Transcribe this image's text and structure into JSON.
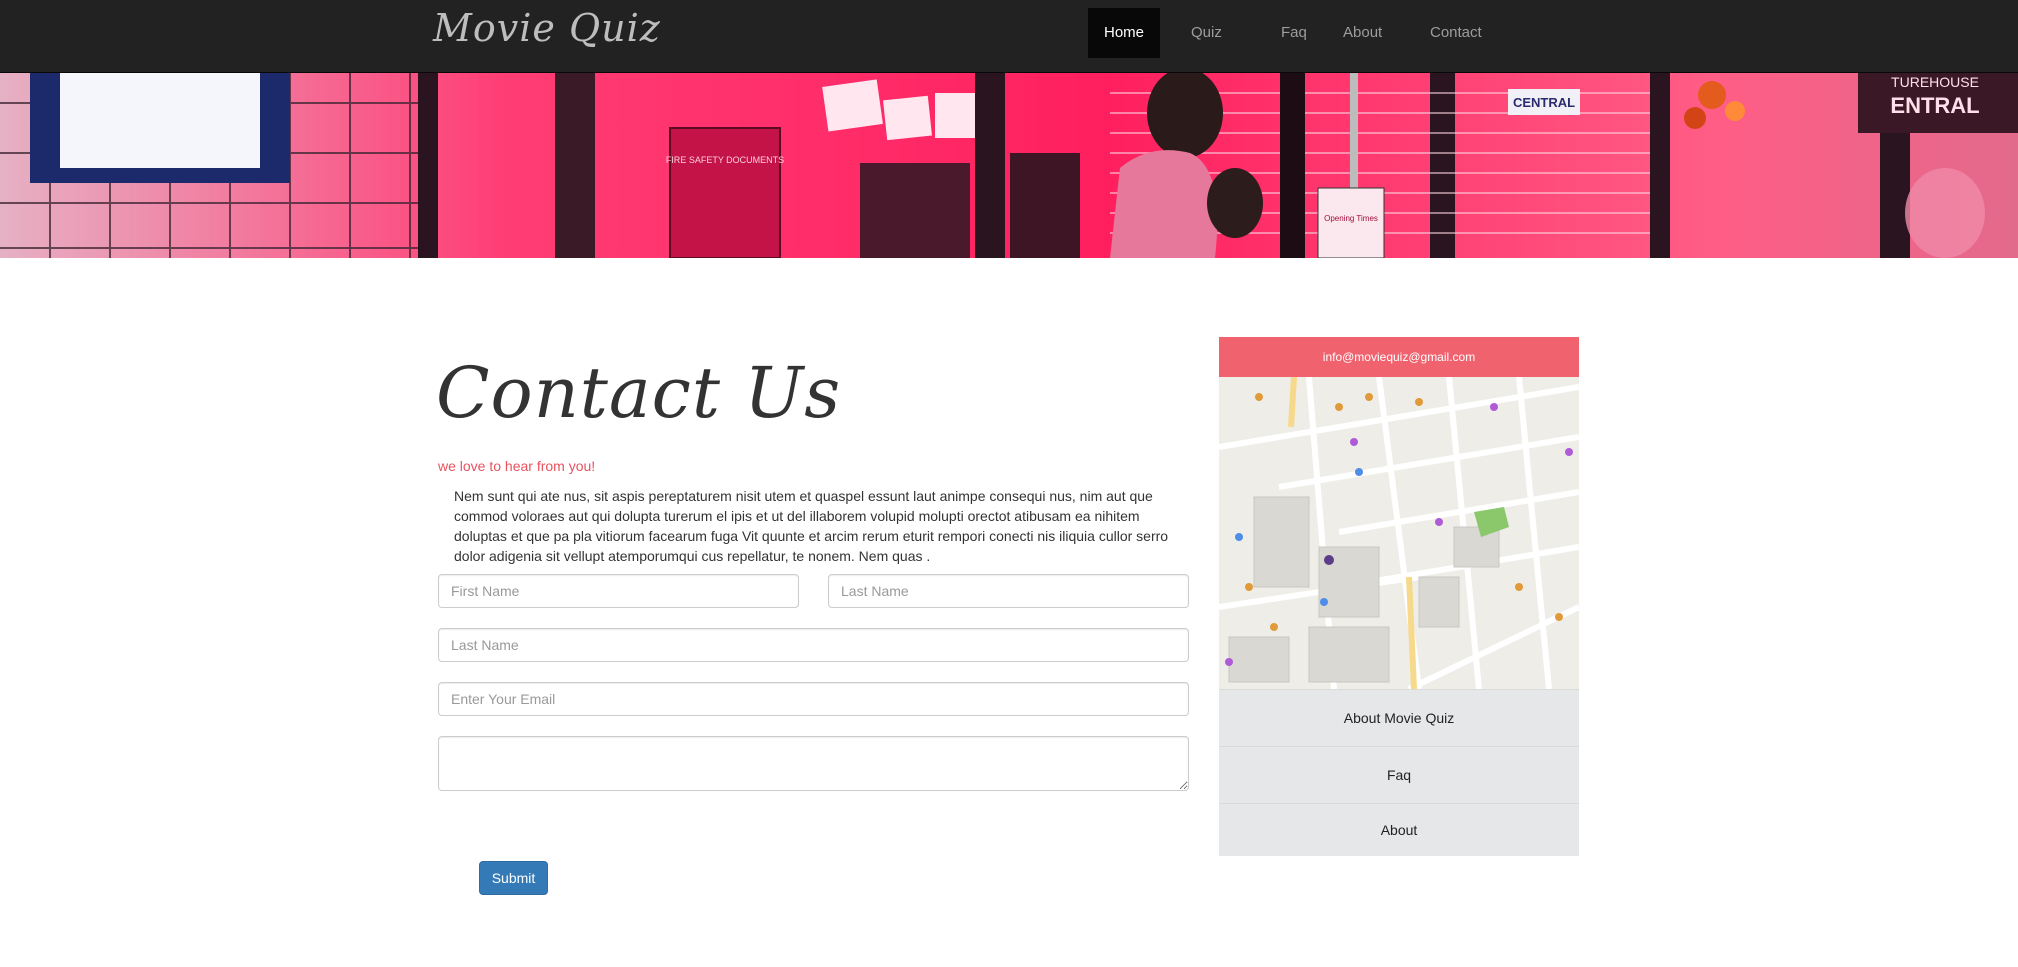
{
  "nav": {
    "brand": "Movie Quiz",
    "items": [
      {
        "label": "Home",
        "active": true
      },
      {
        "label": "Quiz",
        "active": false
      },
      {
        "label": "Faq",
        "active": false
      },
      {
        "label": "About",
        "active": false
      },
      {
        "label": "Contact",
        "active": false
      }
    ]
  },
  "hero": {
    "signs": {
      "central": "CENTRAL",
      "picturehouse": "TUREHOUSE",
      "picturehouse_big": "ENTRAL",
      "fire_box": "FIRE SAFETY DOCUMENTS",
      "opening": "Opening Times"
    }
  },
  "contact": {
    "title": "Contact Us",
    "tagline": "we love to hear from you!",
    "body": "Nem sunt qui ate nus, sit aspis pereptaturem nisit utem et quaspel essunt laut animpe consequi nus, nim aut que commod voloraes aut qui dolupta turerum el ipis et ut del illaborem volupid molupti orectot atibusam ea nihitem doluptas et que pa pla vitiorum facearum fuga Vit quunte et arcim rerum eturit rempori conecti nis iliquia cullor serro dolor adigenia sit vellupt atemporumqui cus repellatur, te nonem. Nem quas .",
    "form": {
      "first_name_placeholder": "First Name",
      "last_name_placeholder": "Last Name",
      "last_name2_placeholder": "Last Name",
      "email_placeholder": "Enter Your Email",
      "message_placeholder": "",
      "submit_label": "Submit"
    }
  },
  "sidebar": {
    "email": "info@moviequiz@gmail.com",
    "links": [
      {
        "label": "About Movie Quiz"
      },
      {
        "label": "Faq"
      },
      {
        "label": "About"
      }
    ]
  },
  "colors": {
    "navbar": "#222222",
    "accent": "#f0626e",
    "tagline": "#e8525f",
    "submit": "#337ab7",
    "hero_pink": "#ff2f6d"
  }
}
